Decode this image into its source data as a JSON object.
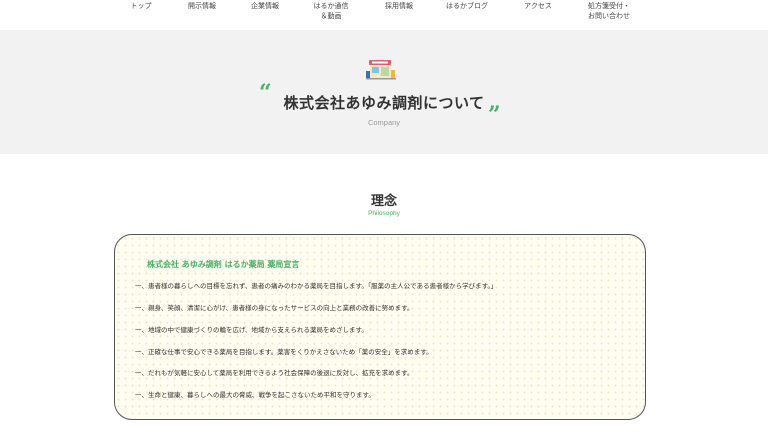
{
  "nav": {
    "items": [
      {
        "label": "トップ"
      },
      {
        "label": "開示情報"
      },
      {
        "label": "企業情報"
      },
      {
        "label": "はるか通信\n＆動画"
      },
      {
        "label": "採用情報"
      },
      {
        "label": "はるかブログ"
      },
      {
        "label": "アクセス"
      },
      {
        "label": "処方箋受付・\nお問い合わせ"
      }
    ]
  },
  "hero": {
    "open_quote": "“",
    "close_quote": "”",
    "title": "株式会社あゆみ調剤について",
    "subtitle": "Company",
    "illustration_icon": "pharmacy-shop-icon"
  },
  "philosophy": {
    "title": "理念",
    "subtitle": "Philosophy",
    "card_heading": "株式会社 あゆみ調剤 はるか薬局 薬局宣言",
    "principles": [
      "一、患者様の暮らしへの目標を忘れず、患者の痛みのわかる薬局を目指します。「服薬の主人公である患者様から学びます。」",
      "一、親身、笑顔、清潔に心がけ、患者様の身になったサービスの向上と業務の改善に努めます。",
      "一、地域の中で健康づくりの輪を広げ、地域から支えられる薬局をめざします。",
      "一、正確な仕事で安心できる薬局を目指します。薬害をくりかえさないため「薬の安全」を求めます。",
      "一、だれもが気軽に安心して薬局を利用できるよう社会保障の後退に反対し、拡充を求めます。",
      "一、生命と健康、暮らしへの最大の脅威、戦争を起こさないため平和を守ります。"
    ]
  },
  "colors": {
    "accent": "#4caf6a",
    "hero_bg": "#f2f2f2",
    "card_bg": "#fffdf2"
  }
}
